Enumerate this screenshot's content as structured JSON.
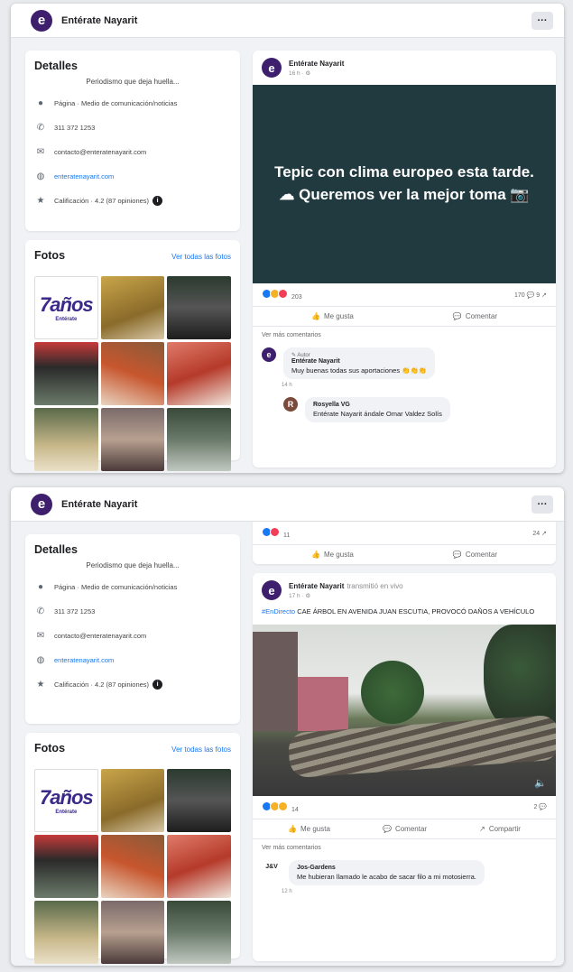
{
  "page": {
    "name": "Entérate Nayarit",
    "more_label": "···"
  },
  "details": {
    "title": "Detalles",
    "intro": "Periodismo que deja huella...",
    "page_type": "Página · Medio de comunicación/noticias",
    "phone": "311 372 1253",
    "email": "contacto@enteratenayarit.com",
    "website": "enteratenayarit.com",
    "rating": "Calificación · 4.2 (87 opiniones)"
  },
  "photos": {
    "title": "Fotos",
    "see_all": "Ver todas las fotos",
    "anniv_big": "7años",
    "anniv_small": "Entérate"
  },
  "post1": {
    "author": "Entérate Nayarit",
    "time": "16 h · ⚙",
    "text": "Tepic con clima europeo esta tarde. ☁ Queremos ver la mejor toma 📷",
    "reactions": "203",
    "counts": "170 💬   9 ↗",
    "like": "Me gusta",
    "comment": "Comentar",
    "more_comments": "Ver más comentarios",
    "c1_badge": "✎ Autor",
    "c1_name": "Entérate Nayarit",
    "c1_text": "Muy buenas todas sus aportaciones 👏👏👏",
    "c1_time": "14 h",
    "c2_name": "Rosyella VG",
    "c2_text": "Entérate Nayarit ándale Omar Valdez Solís"
  },
  "post2": {
    "top_reactions": "11",
    "top_counts": "24 ↗",
    "like": "Me gusta",
    "comment": "Comentar",
    "share": "Compartir",
    "author": "Entérate Nayarit",
    "author_sub": "transmitió en vivo",
    "time": "17 h · ⚙",
    "hashtag": "#EnDirecto",
    "headline": " CAE ÁRBOL EN AVENIDA JUAN ESCUTIA, PROVOCÓ DAÑOS A VEHÍCULO",
    "reactions": "14",
    "counts": "2 💬",
    "more_comments": "Ver más comentarios",
    "c1_avatar": "J&V",
    "c1_name": "Jos-Gardens",
    "c1_text": "Me hubieran llamado le acabo de sacar filo a mi motosierra.",
    "c1_time": "12 h"
  }
}
